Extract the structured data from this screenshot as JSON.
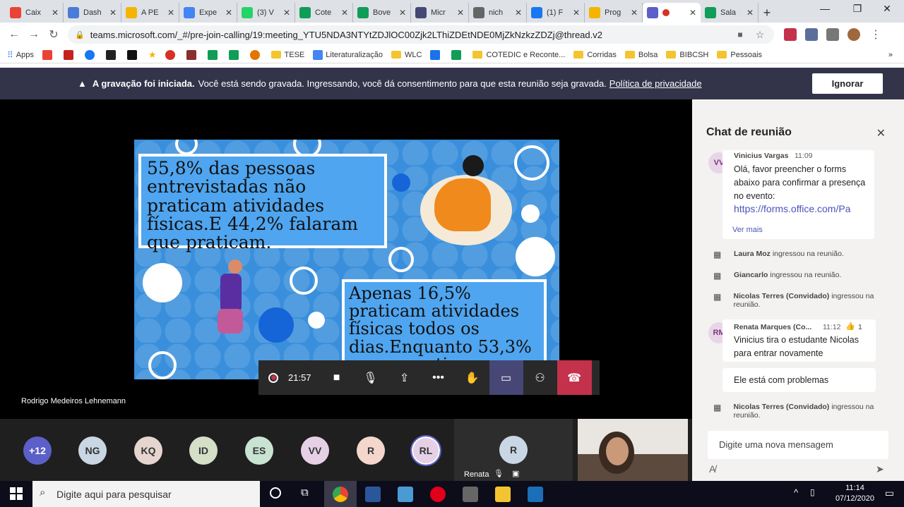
{
  "browser": {
    "tabs": [
      {
        "label": "Caix",
        "icon": "gmail-icon",
        "color": "#ea4335"
      },
      {
        "label": "Dash",
        "icon": "globe-icon",
        "color": "#4a7bd6"
      },
      {
        "label": "A PE",
        "icon": "slides-icon",
        "color": "#f4b400"
      },
      {
        "label": "Expe",
        "icon": "docs-icon",
        "color": "#4285f4"
      },
      {
        "label": "(3) V",
        "icon": "whatsapp-icon",
        "color": "#25d366"
      },
      {
        "label": "Cote",
        "icon": "sheets-icon",
        "color": "#0f9d58"
      },
      {
        "label": "Bove",
        "icon": "sheets-icon",
        "color": "#0f9d58"
      },
      {
        "label": "Micr",
        "icon": "gear-icon",
        "color": "#464775"
      },
      {
        "label": "nich",
        "icon": "globe-icon",
        "color": "#666666"
      },
      {
        "label": "(1) F",
        "icon": "facebook-icon",
        "color": "#1877f2"
      },
      {
        "label": "Prog",
        "icon": "drive-icon",
        "color": "#f4b400"
      },
      {
        "label": "",
        "icon": "teams-icon",
        "color": "#5b5fc7"
      },
      {
        "label": "Sala",
        "icon": "drive-icon",
        "color": "#0f9d58"
      }
    ],
    "url": "teams.microsoft.com/_#/pre-join-calling/19:meeting_YTU5NDA3NTYtZDJlOC00Zjk2LThiZDEtNDE0MjZkNzkzZDZj@thread.v2",
    "bookmarks": [
      {
        "label": "Apps",
        "type": "apps"
      },
      {
        "label": "TESE",
        "type": "folder"
      },
      {
        "label": "Literaturalização",
        "type": "translate"
      },
      {
        "label": "WLC",
        "type": "folder"
      },
      {
        "label": "COTEDIC e Reconte...",
        "type": "folder"
      },
      {
        "label": "Corridas",
        "type": "folder"
      },
      {
        "label": "Bolsa",
        "type": "folder"
      },
      {
        "label": "BIBCSH",
        "type": "folder"
      },
      {
        "label": "Pessoais",
        "type": "folder"
      }
    ]
  },
  "banner": {
    "bold": "A gravação foi iniciada.",
    "text": "Você está sendo gravada. Ingressando, você dá consentimento para que esta reunião seja gravada.",
    "link": "Política de privacidade",
    "dismiss": "Ignorar"
  },
  "slide": {
    "stat1": "55,8% das pessoas entrevistadas não praticam atividades físicas.E 44,2% falaram que praticam.",
    "stat2": "Apenas 16,5% praticam atividades físicas todos os dias.Enquanto 53,3% nunca praticam."
  },
  "controls": {
    "timer": "21:57"
  },
  "presenter_name": "Rodrigo Medeiros Lehnemann",
  "participants": [
    {
      "initials": "+12",
      "bg": "#5b5fc7",
      "fg": "#ffffff"
    },
    {
      "initials": "NG",
      "bg": "#c9d6e3",
      "fg": "#333333"
    },
    {
      "initials": "KQ",
      "bg": "#e6d5cf",
      "fg": "#333333"
    },
    {
      "initials": "ID",
      "bg": "#d5dfc8",
      "fg": "#333333"
    },
    {
      "initials": "ES",
      "bg": "#c8e3d2",
      "fg": "#333333"
    },
    {
      "initials": "VV",
      "bg": "#e6d0e6",
      "fg": "#333333"
    },
    {
      "initials": "R",
      "bg": "#f4d6cc",
      "fg": "#333333"
    },
    {
      "initials": "RL",
      "bg": "#e6d0e6",
      "fg": "#333333"
    }
  ],
  "renata_tile": {
    "initials": "R",
    "name": "Renata"
  },
  "chat": {
    "title": "Chat de reunião",
    "msg1": {
      "initials": "VV",
      "author": "Vinicius Vargas",
      "time": "11:09",
      "text": "Olá, favor preencher o forms abaixo para confirmar a presença no evento:",
      "link": "https://forms.office.com/Pa",
      "more": "Ver mais"
    },
    "sys1": {
      "name": "Laura Moz",
      "text": "ingressou na reunião."
    },
    "sys2": {
      "name": "Giancarlo",
      "text": "ingressou na reunião."
    },
    "sys3": {
      "name": "Nicolas Terres (Convidado)",
      "text": "ingressou na reunião."
    },
    "msg2": {
      "initials": "RM",
      "author": "Renata Marques (Co...",
      "time": "11:12",
      "reaction": "1",
      "text": "Vinicius tira o estudante Nicolas para entrar novamente"
    },
    "msg3": {
      "text": "Ele está com problemas"
    },
    "sys4": {
      "name": "Nicolas Terres (Convidado)",
      "text": "ingressou na reunião."
    },
    "compose_placeholder": "Digite uma nova mensagem"
  },
  "taskbar": {
    "search_placeholder": "Digite aqui para pesquisar",
    "time": "11:14",
    "date": "07/12/2020"
  }
}
